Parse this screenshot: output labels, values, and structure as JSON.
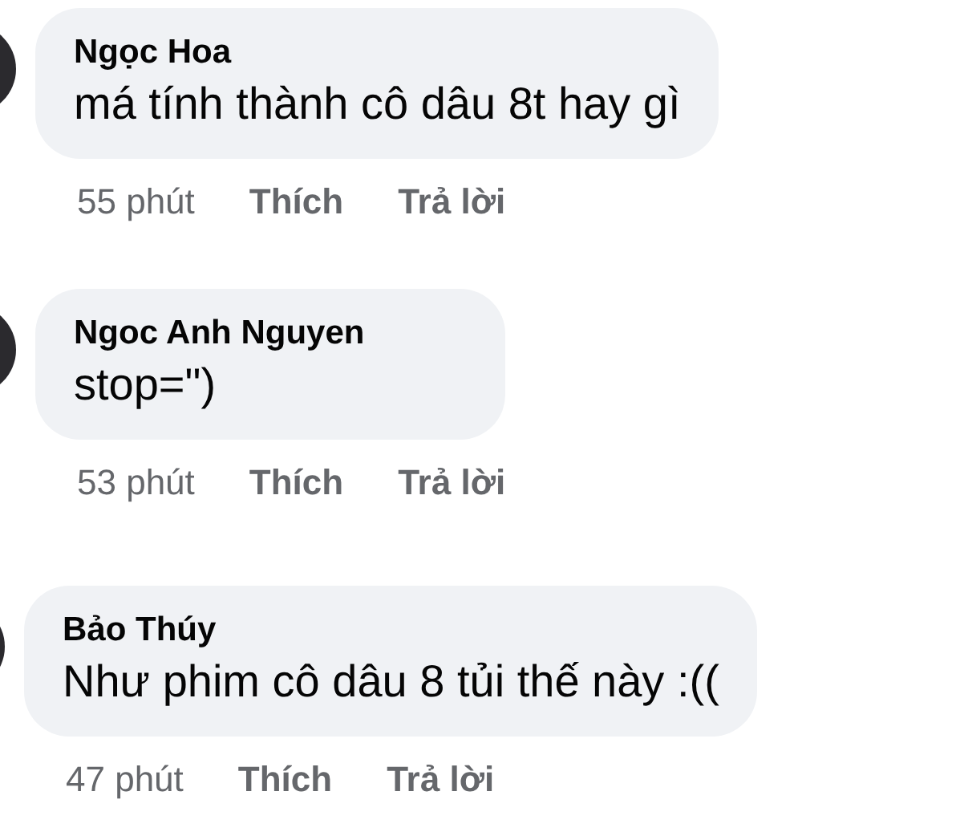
{
  "comments": [
    {
      "author": "Ngọc Hoa",
      "text": "má tính thành cô dâu 8t hay gì",
      "time": "55 phút",
      "like": "Thích",
      "reply": "Trả lời"
    },
    {
      "author": "Ngoc Anh Nguyen",
      "text": "stop=\")",
      "time": "53 phút",
      "like": "Thích",
      "reply": "Trả lời"
    },
    {
      "author": "Bảo Thúy",
      "text": "Như phim cô dâu 8 tủi thế này :((",
      "time": "47 phút",
      "like": "Thích",
      "reply": "Trả lời"
    }
  ]
}
